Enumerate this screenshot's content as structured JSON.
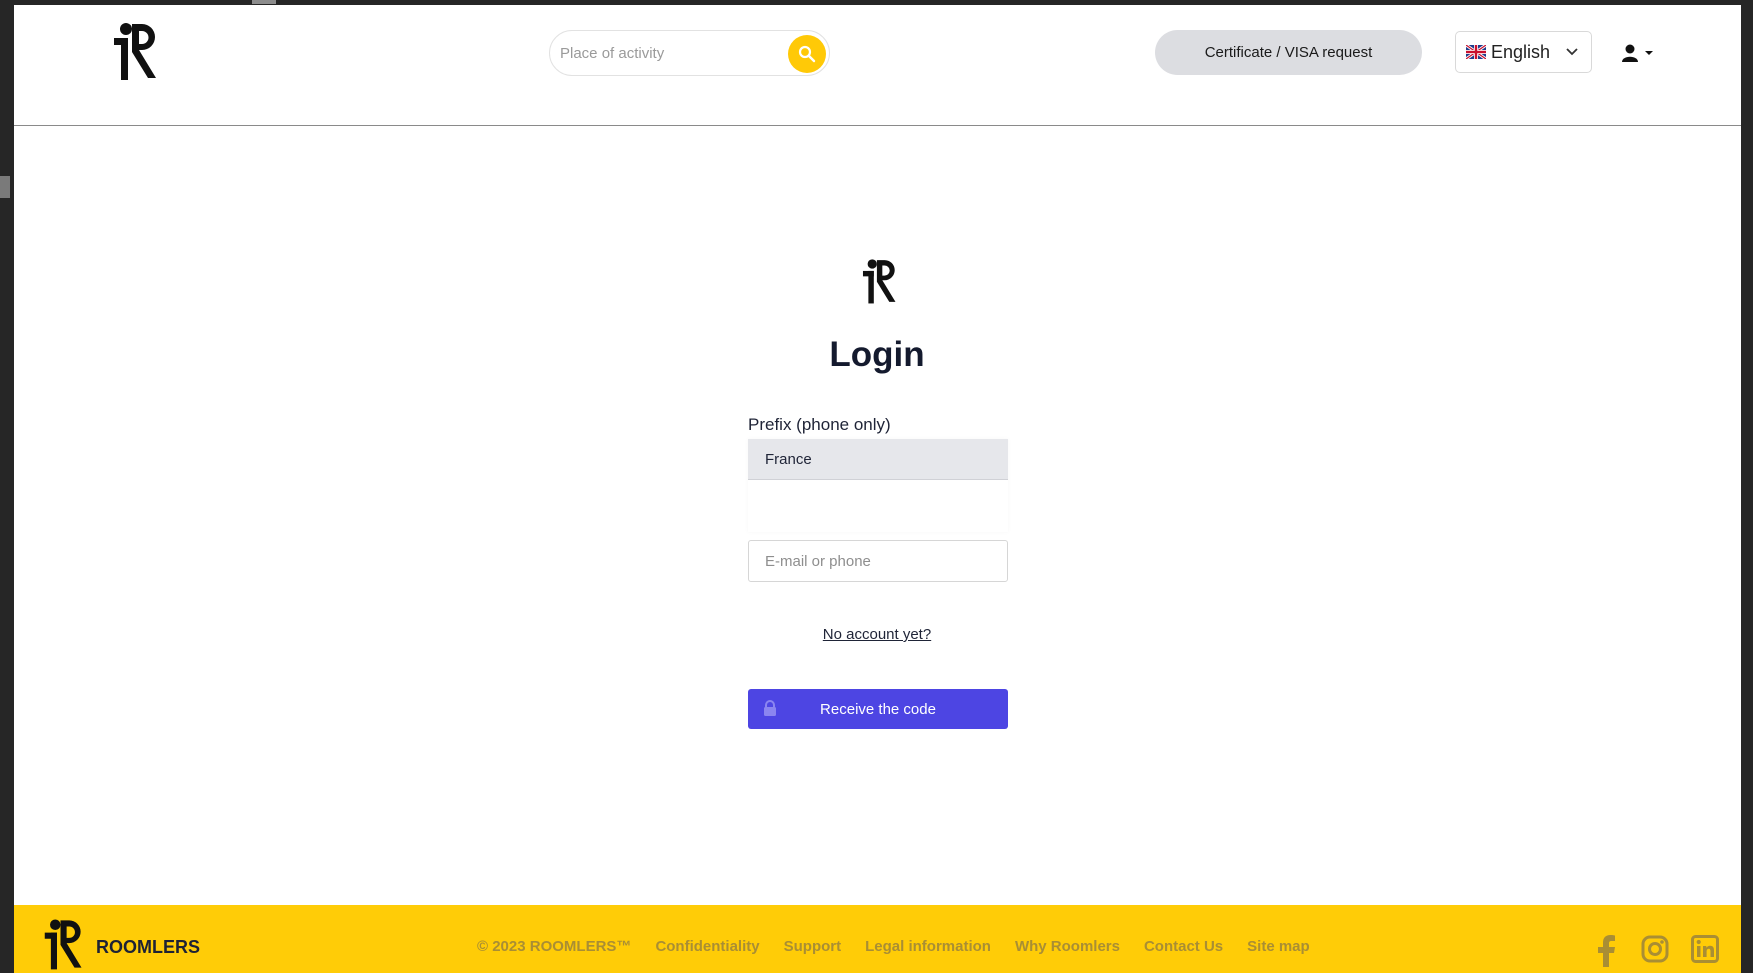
{
  "header": {
    "search_placeholder": "Place of activity",
    "cert_button": "Certificate / VISA request",
    "language": "English"
  },
  "login": {
    "title": "Login",
    "prefix_label": "Prefix (phone only)",
    "prefix_value": "France",
    "email_placeholder": "E-mail or phone",
    "no_account": "No account yet?",
    "receive_button": "Receive the code"
  },
  "footer": {
    "brand": "ROOMLERS",
    "links": [
      "© 2023 ROOMLERS™",
      "Confidentiality",
      "Support",
      "Legal information",
      "Why Roomlers",
      "Contact Us",
      "Site map"
    ]
  },
  "colors": {
    "accent_yellow": "#ffcc07",
    "primary_button": "#4d45e3",
    "footer_link": "#a98e34"
  },
  "icons": [
    "logo-icon",
    "search-icon",
    "uk-flag-icon",
    "chevron-down-icon",
    "user-icon",
    "caret-down-icon",
    "lock-icon",
    "facebook-icon",
    "instagram-icon",
    "linkedin-icon"
  ]
}
